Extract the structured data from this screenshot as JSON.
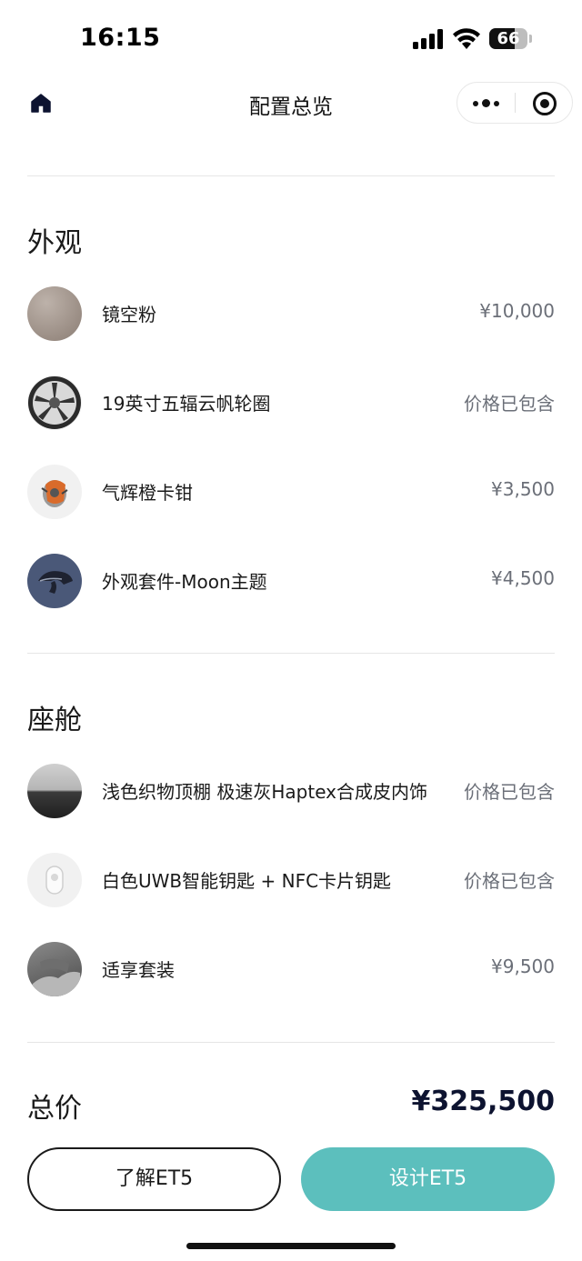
{
  "status_bar": {
    "time": "16:15",
    "battery": "66",
    "battery_fraction": 0.66,
    "signal_icon": "cellular-signal-icon",
    "wifi_icon": "wifi-icon"
  },
  "nav": {
    "title": "配置总览",
    "home_icon": "home-icon",
    "more_icon": "more-dots-icon",
    "close_icon": "target-close-icon"
  },
  "exterior": {
    "title": "外观",
    "items": [
      {
        "name": "镜空粉",
        "price": "¥10,000",
        "thumb": "paint-swatch",
        "color": "#a79b92"
      },
      {
        "name": "19英寸五辐云帆轮圈",
        "price": "价格已包含",
        "thumb": "wheel-rim"
      },
      {
        "name": "气辉橙卡钳",
        "price": "¥3,500",
        "thumb": "brake-caliper"
      },
      {
        "name": "外观套件-Moon主题",
        "price": "¥4,500",
        "thumb": "exterior-kit",
        "color": "#4a5878"
      }
    ]
  },
  "cabin": {
    "title": "座舱",
    "items": [
      {
        "name": "浅色织物顶棚 极速灰Haptex合成皮内饰",
        "price": "价格已包含",
        "thumb": "interior-fabric"
      },
      {
        "name": "白色UWB智能钥匙 + NFC卡片钥匙",
        "price": "价格已包含",
        "thumb": "smart-key"
      },
      {
        "name": "适享套装",
        "price": "¥9,500",
        "thumb": "seat-package"
      }
    ]
  },
  "total": {
    "label": "总价",
    "value": "¥325,500"
  },
  "actions": {
    "learn_label": "了解ET5",
    "design_label": "设计ET5",
    "design_color": "#5cbfbd"
  }
}
